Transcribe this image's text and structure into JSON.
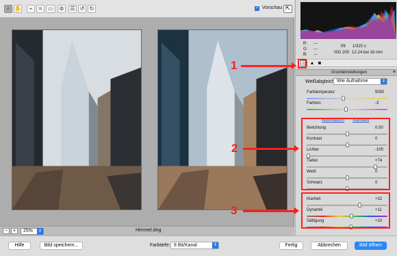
{
  "toolbar": {
    "icons": [
      "zoom-icon",
      "hand-icon",
      "eyedropper-icon",
      "crop-icon",
      "straighten-icon",
      "red-eye-icon",
      "list-icon",
      "rotate-left-icon",
      "rotate-right-icon"
    ],
    "preview_label": "Vorschau",
    "preview_checked": true
  },
  "status": {
    "zoom": "25%",
    "filename": "Himmel.dng"
  },
  "footer": {
    "help": "Hilfe",
    "save": "Bild speichern...",
    "depth_label": "Farbtiefe:",
    "depth_value": "8 Bit/Kanal",
    "done": "Fertig",
    "cancel": "Abbrechen",
    "open": "Bild öffnen"
  },
  "panel": {
    "rgb": {
      "r_label": "R:",
      "g_label": "G:",
      "b_label": "B:",
      "r_value": "---",
      "g_value": "---",
      "b_value": "---"
    },
    "exif": {
      "aperture": "f/9",
      "shutter": "1/320 s",
      "iso": "ISO 200",
      "lens": "12-24 bei 18 mm"
    },
    "section_title": "Grundeinstellungen",
    "white_balance_label": "Weißabgleich:",
    "white_balance_value": "Wie Aufnahme",
    "temp": {
      "label": "Farbtemperatur",
      "value": "5050",
      "fraction": 0.45
    },
    "tint": {
      "label": "Farbton",
      "value": "-3",
      "fraction": 0.49
    },
    "auto_label": "Automatisch",
    "standard_label": "Standard",
    "exposure": {
      "label": "Belichtung",
      "value": "0.00",
      "fraction": 0.5
    },
    "contrast": {
      "label": "Kontrast",
      "value": "0",
      "fraction": 0.5
    },
    "highlights": {
      "label": "Lichter",
      "value": "-100",
      "fraction": 0.0
    },
    "shadows": {
      "label": "Tiefen",
      "value": "+74",
      "fraction": 0.87
    },
    "whites": {
      "label": "Weiß",
      "value": "0",
      "fraction": 0.5
    },
    "blacks": {
      "label": "Schwarz",
      "value": "0",
      "fraction": 0.5
    },
    "clarity": {
      "label": "Klarheit",
      "value": "+32",
      "fraction": 0.66
    },
    "vibrance": {
      "label": "Dynamik",
      "value": "+11",
      "fraction": 0.555
    },
    "saturation": {
      "label": "Sättigung",
      "value": "+10",
      "fraction": 0.55
    }
  },
  "annotations": {
    "one": "1",
    "two": "2",
    "three": "3"
  }
}
